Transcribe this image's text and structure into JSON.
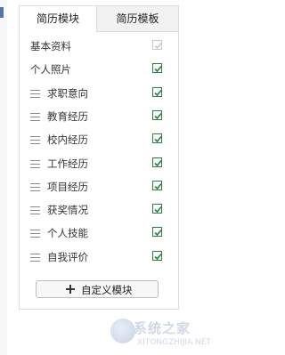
{
  "tabs": [
    {
      "label": "简历模块",
      "active": true
    },
    {
      "label": "简历模板",
      "active": false
    }
  ],
  "modules": [
    {
      "label": "基本资料",
      "checked": true,
      "disabled": true,
      "draggable": false
    },
    {
      "label": "个人照片",
      "checked": true,
      "disabled": false,
      "draggable": false
    },
    {
      "label": "求职意向",
      "checked": true,
      "disabled": false,
      "draggable": true
    },
    {
      "label": "教育经历",
      "checked": true,
      "disabled": false,
      "draggable": true
    },
    {
      "label": "校内经历",
      "checked": true,
      "disabled": false,
      "draggable": true
    },
    {
      "label": "工作经历",
      "checked": true,
      "disabled": false,
      "draggable": true
    },
    {
      "label": "项目经历",
      "checked": true,
      "disabled": false,
      "draggable": true
    },
    {
      "label": "获奖情况",
      "checked": true,
      "disabled": false,
      "draggable": true
    },
    {
      "label": "个人技能",
      "checked": true,
      "disabled": false,
      "draggable": true
    },
    {
      "label": "自我评价",
      "checked": true,
      "disabled": false,
      "draggable": true
    }
  ],
  "custom_button": {
    "label": "自定义模块",
    "icon": "plus-icon"
  },
  "watermark": {
    "text": "系统之家",
    "url": "XITONGZHIJIA.NET"
  },
  "colors": {
    "check": "#2e7d46",
    "check_disabled": "#c8c8c8",
    "accent": "#5a73a6"
  }
}
